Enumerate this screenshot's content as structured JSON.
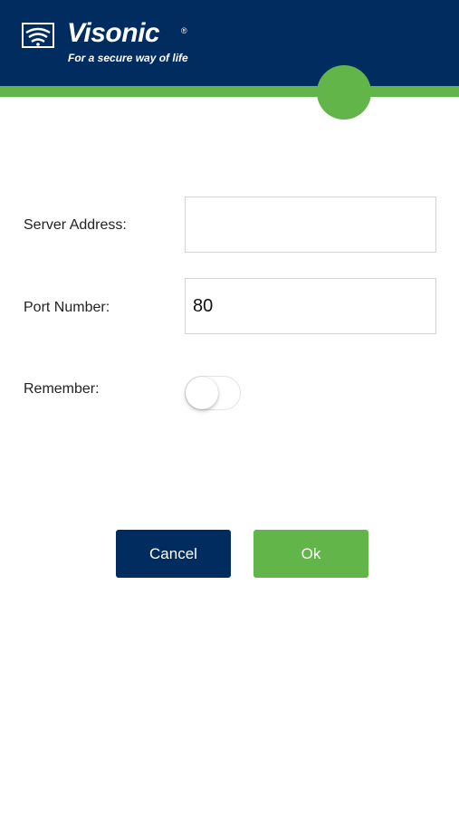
{
  "header": {
    "brand_name": "Visonic",
    "registered_mark": "®",
    "tagline": "For a secure way of life",
    "logo_icon": "wifi-signal-icon"
  },
  "form": {
    "server_address": {
      "label": "Server Address:",
      "value": ""
    },
    "port_number": {
      "label": "Port Number:",
      "value": "80"
    },
    "remember": {
      "label": "Remember:",
      "on": false
    }
  },
  "buttons": {
    "cancel_label": "Cancel",
    "ok_label": "Ok"
  },
  "colors": {
    "navy": "#002c60",
    "green": "#62b548"
  }
}
